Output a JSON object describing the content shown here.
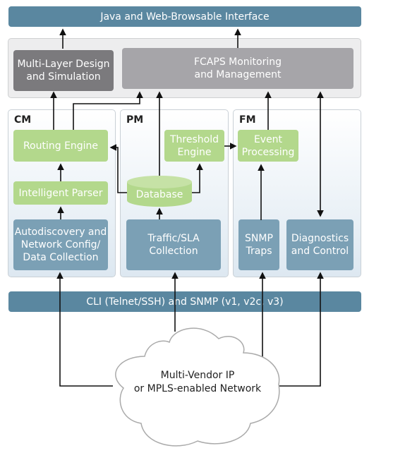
{
  "top_bar": "Java and Web-Browsable Interface",
  "upper": {
    "design": "Multi-Layer Design\nand Simulation",
    "fcaps": "FCAPS Monitoring\nand Management"
  },
  "columns": {
    "cm": "CM",
    "pm": "PM",
    "fm": "FM"
  },
  "cm": {
    "routing": "Routing Engine",
    "parser": "Intelligent Parser",
    "autodiscovery": "Autodiscovery and\nNetwork Config/\nData Collection"
  },
  "pm": {
    "threshold": "Threshold\nEngine",
    "database": "Database",
    "traffic": "Traffic/SLA\nCollection"
  },
  "fm": {
    "event": "Event\nProcessing",
    "snmp": "SNMP\nTraps",
    "diagnostics": "Diagnostics\nand Control"
  },
  "bottom_bar": "CLI (Telnet/SSH) and SNMP (v1, v2c, v3)",
  "cloud": "Multi-Vendor IP\nor MPLS-enabled Network",
  "colors": {
    "bar": "#5a87a0",
    "green": "#b3d88c",
    "blue": "#7ba0b5",
    "dark": "#7b7a7d",
    "grey": "#a6a5a9"
  }
}
